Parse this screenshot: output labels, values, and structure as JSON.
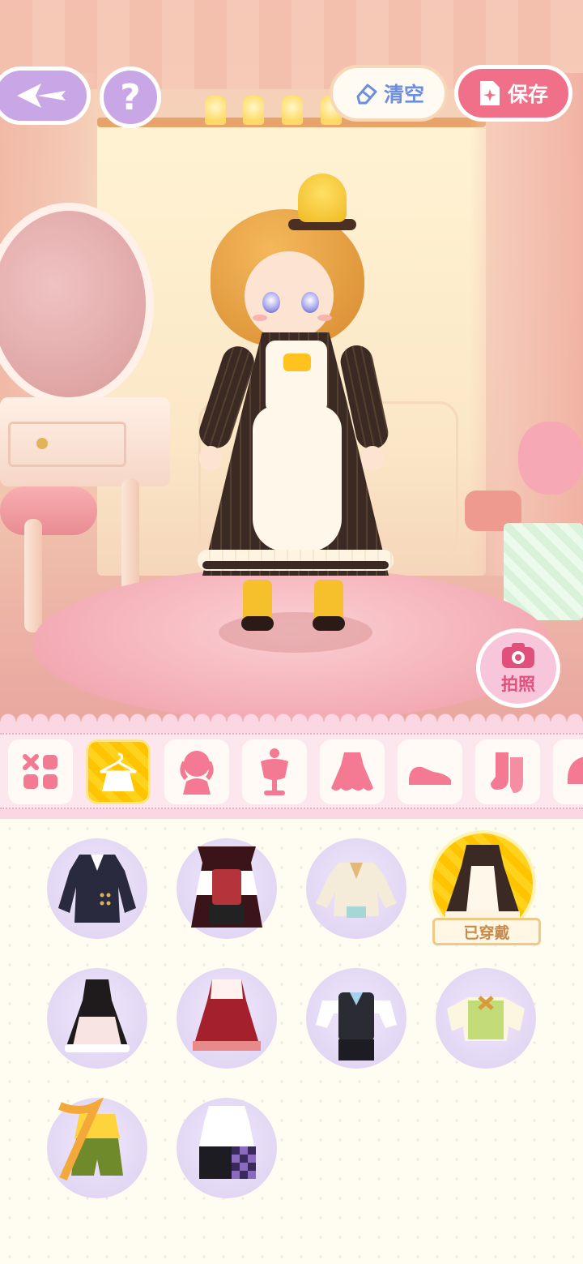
{
  "header": {
    "clear_label": "清空",
    "save_label": "保存",
    "help_glyph": "?"
  },
  "scene": {
    "photo_label": "拍照"
  },
  "categories": [
    {
      "name": "all-icon",
      "active": false
    },
    {
      "name": "outfit-hanger-icon",
      "active": true
    },
    {
      "name": "hair-icon",
      "active": false
    },
    {
      "name": "accessory-bust-icon",
      "active": false
    },
    {
      "name": "dress-icon",
      "active": false
    },
    {
      "name": "shoe-icon",
      "active": false
    },
    {
      "name": "socks-icon",
      "active": false
    },
    {
      "name": "hat-icon",
      "active": false
    }
  ],
  "items": [
    {
      "name": "navy-coat-outfit"
    },
    {
      "name": "vampire-red-vest-outfit"
    },
    {
      "name": "cream-embroidered-coat-outfit"
    },
    {
      "name": "striped-maid-dress-outfit",
      "worn": true,
      "tag": "已穿戴"
    },
    {
      "name": "black-lace-dress-outfit"
    },
    {
      "name": "red-plaid-dress-outfit"
    },
    {
      "name": "butler-vest-outfit"
    },
    {
      "name": "green-check-sweater-outfit"
    },
    {
      "name": "green-shorts-scarf-outfit"
    },
    {
      "name": "checkered-streetwear-outfit"
    }
  ],
  "colors": {
    "accent_pink": "#f0708a",
    "accent_yellow": "#ffc400",
    "clear_blue": "#6c8ee0",
    "lavender": "#c9a6e6"
  }
}
